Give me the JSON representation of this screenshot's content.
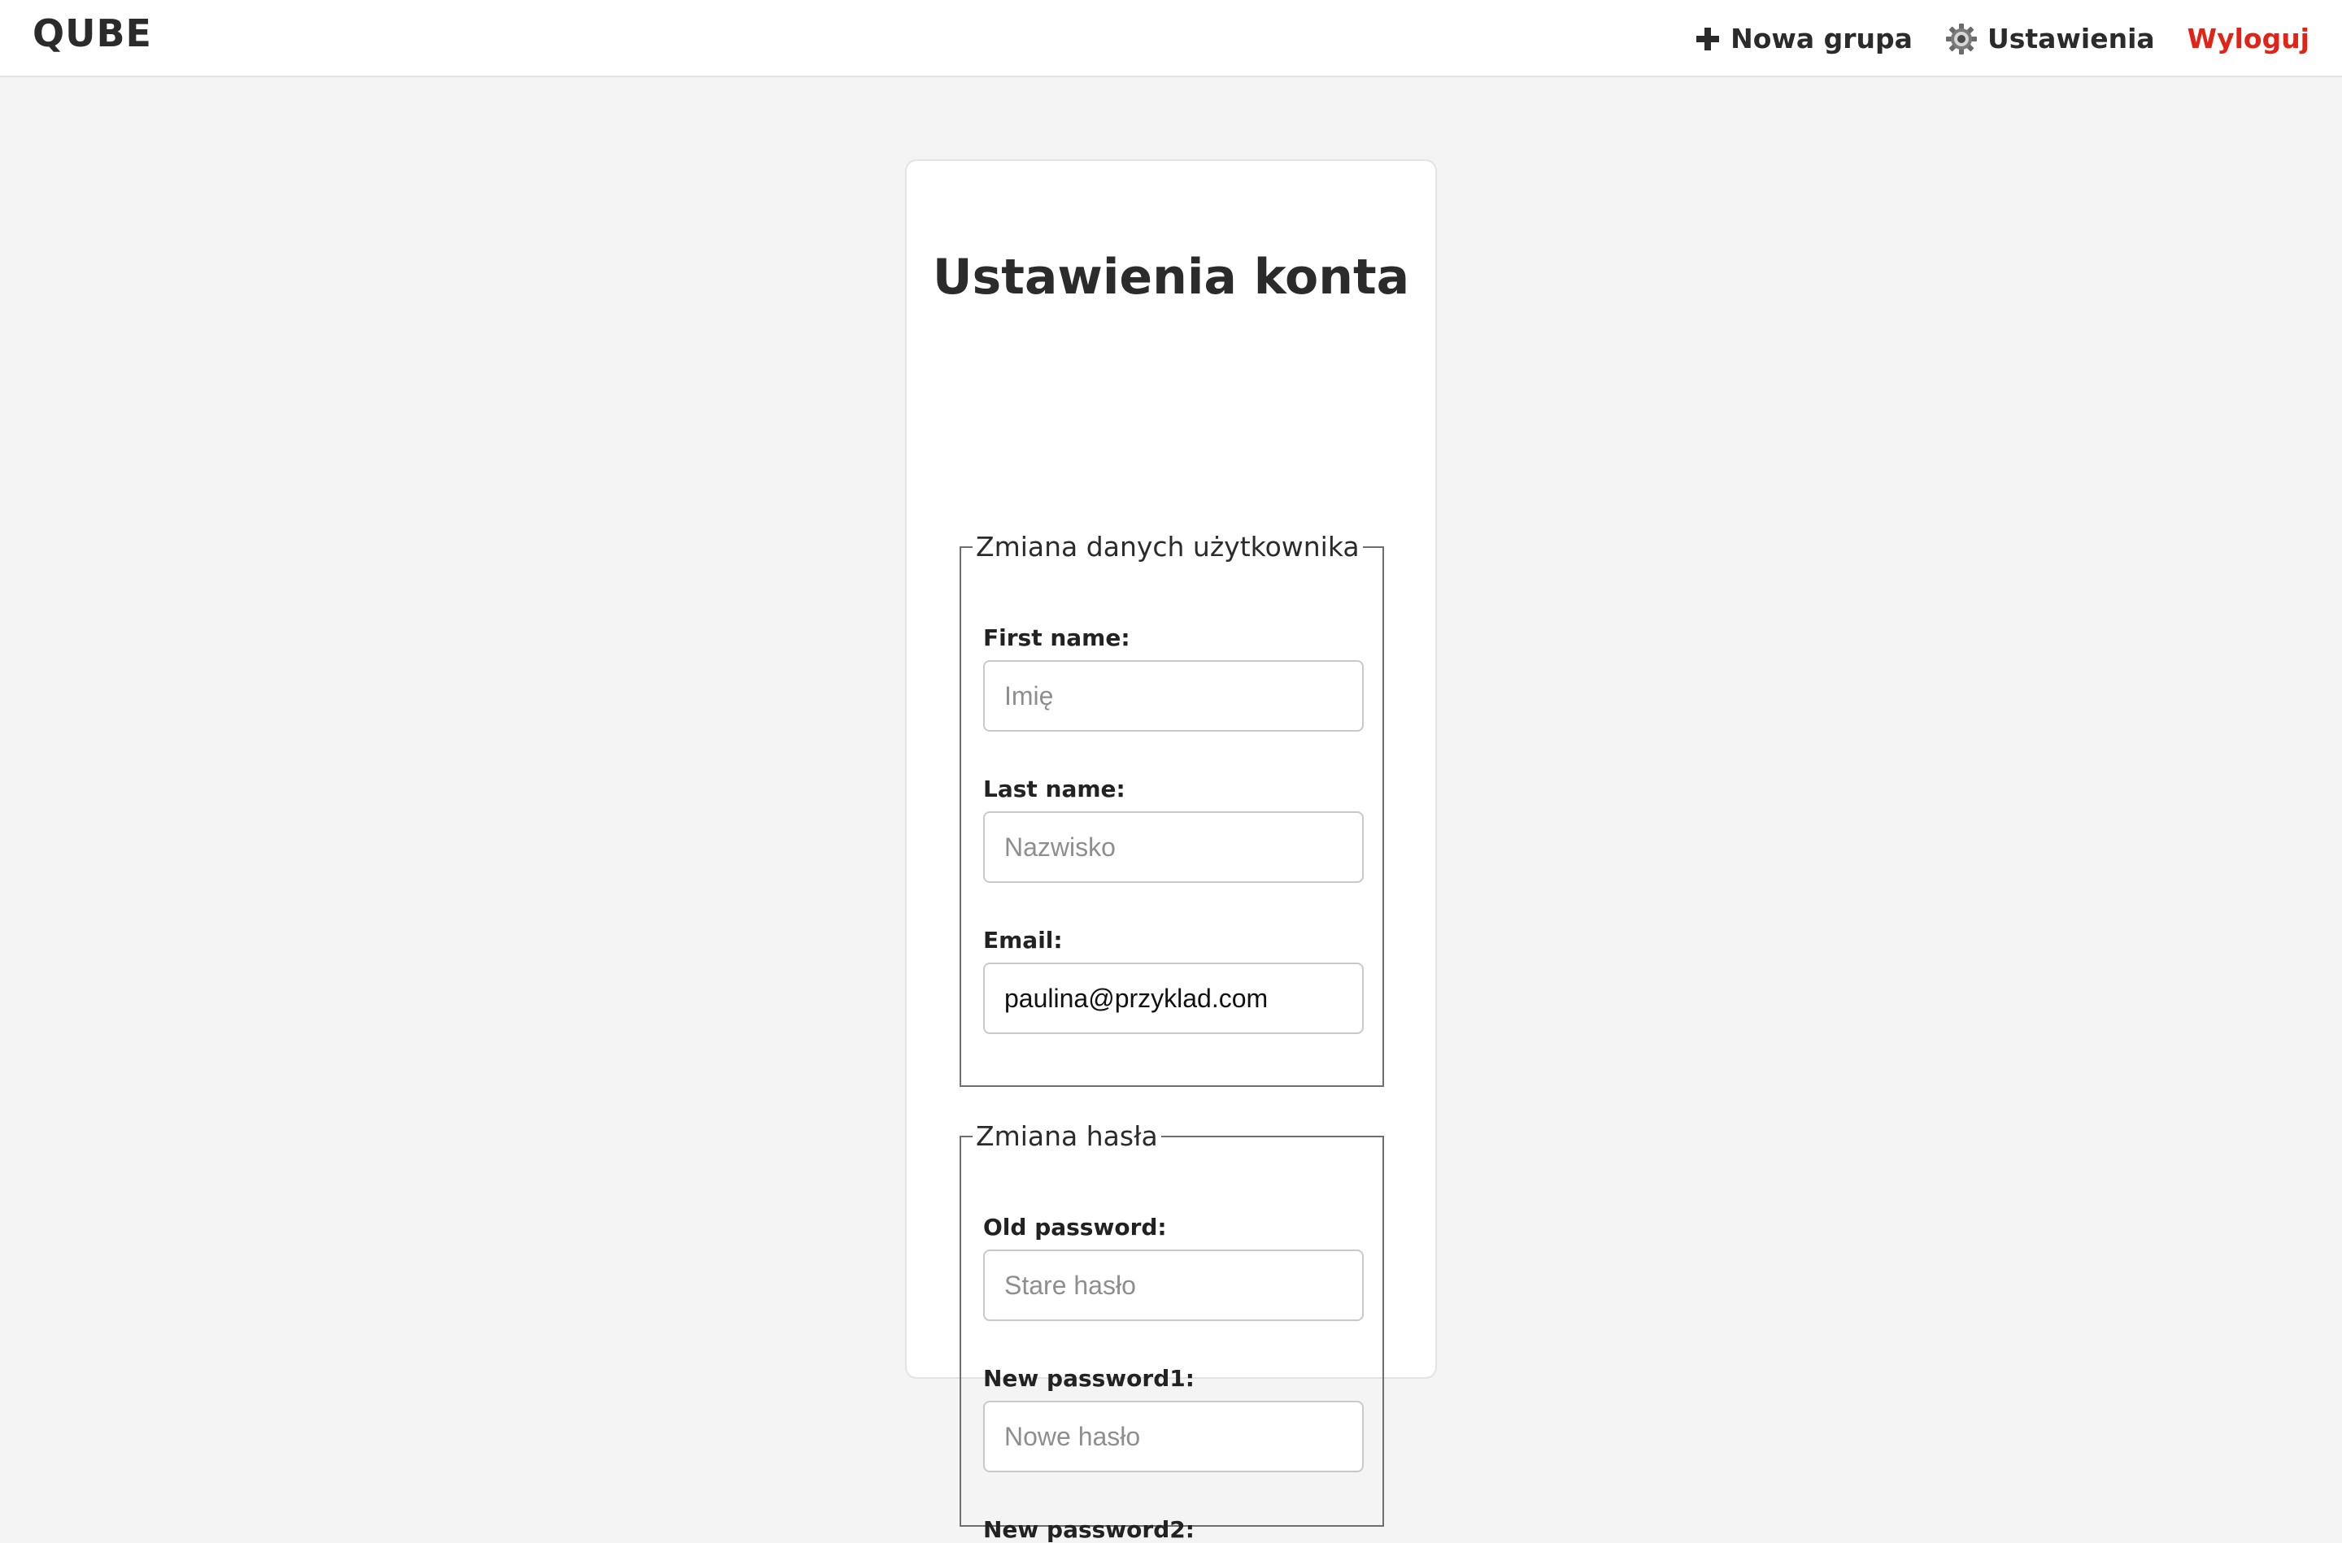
{
  "header": {
    "brand": "QUBE",
    "nav": {
      "new_group_label": "Nowa grupa",
      "settings_label": "Ustawienia",
      "logout_label": "Wyloguj"
    },
    "logout_color": "#e02418"
  },
  "card": {
    "title": "Ustawienia konta",
    "user_section": {
      "legend": "Zmiana danych użytkownika",
      "first_name": {
        "label": "First name:",
        "placeholder": "Imię",
        "value": ""
      },
      "last_name": {
        "label": "Last name:",
        "placeholder": "Nazwisko",
        "value": ""
      },
      "email": {
        "label": "Email:",
        "placeholder": "",
        "value": "paulina@przyklad.com"
      }
    },
    "password_section": {
      "legend": "Zmiana hasła",
      "old_password": {
        "label": "Old password:",
        "placeholder": "Stare hasło"
      },
      "new_password1": {
        "label": "New password1:",
        "placeholder": "Nowe hasło"
      },
      "new_password2": {
        "label": "New password2:"
      }
    }
  }
}
